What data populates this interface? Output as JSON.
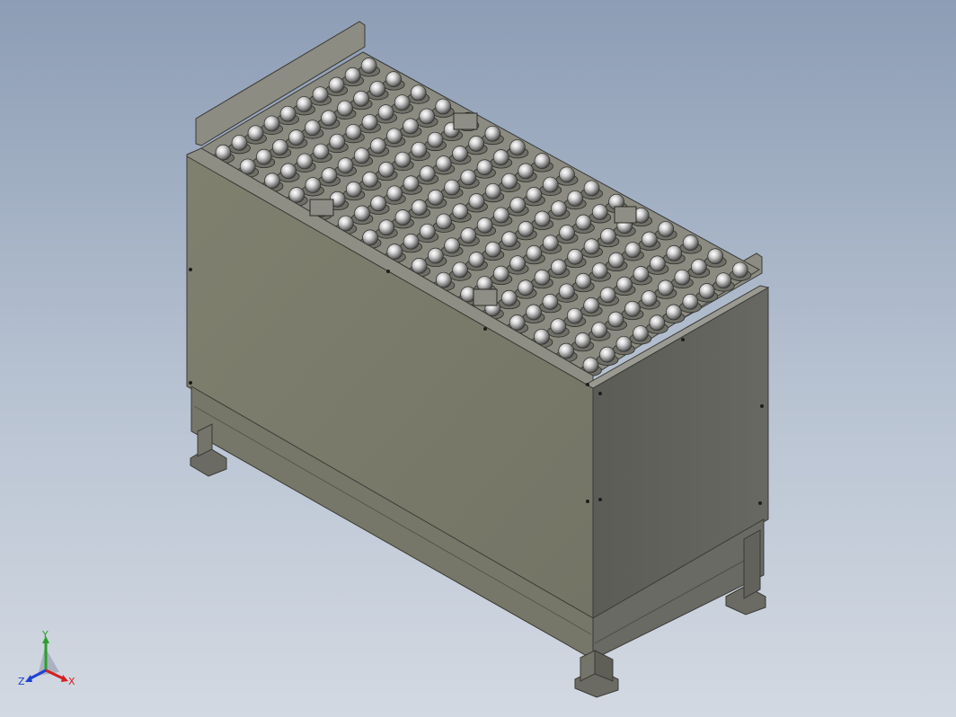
{
  "viewport": {
    "model": {
      "type": "ball transfer table",
      "ball_rows": 16,
      "balls_per_row": 10
    },
    "triad": {
      "axis_x": "X",
      "axis_y": "Y",
      "axis_z": "Z",
      "colors": {
        "x": "#d32020",
        "y": "#2aa02a",
        "z": "#2040d0"
      }
    },
    "colors": {
      "background_top": "#8d9db5",
      "background_bottom": "#d3d9e2",
      "front_panel": "#7b7b6c",
      "side_panel": "#5e5e58",
      "top_plate": "#8a8a80",
      "ball": "#c9c9c9"
    }
  }
}
